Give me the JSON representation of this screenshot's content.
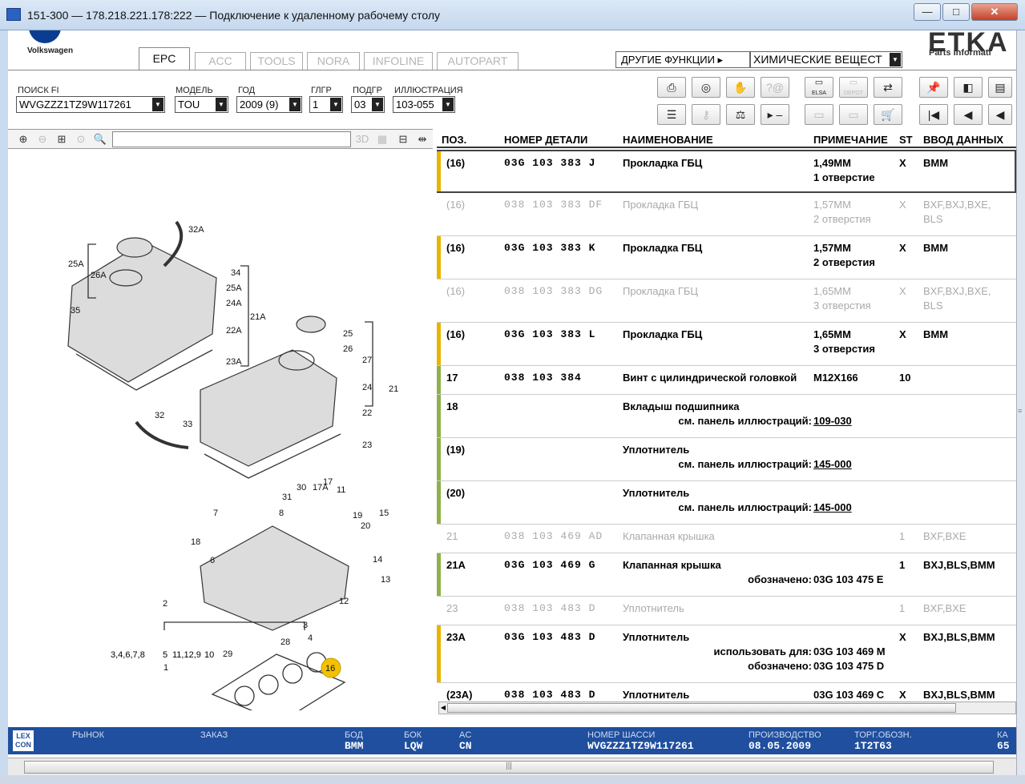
{
  "window": {
    "title": "151-300 — 178.218.221.178:222 — Подключение к удаленному рабочему столу",
    "minimize": "—",
    "restore": "□",
    "close": "✕"
  },
  "brand": {
    "vw": "Volkswagen",
    "etka": "ETKA",
    "etka_sub": "Parts Informati"
  },
  "tabs": [
    "EPC",
    "ACC",
    "TOOLS",
    "NORA",
    "INFOLINE",
    "AUTOPART"
  ],
  "other_functions": "ДРУГИЕ ФУНКЦИИ ▸",
  "chem_select": "ХИМИЧЕСКИЕ ВЕЩЕСТ",
  "fields": {
    "fi_label": "ПОИСК FI",
    "fi_value": "WVGZZZ1TZ9W117261",
    "model_label": "МОДЕЛЬ",
    "model_value": "TOU",
    "year_label": "ГОД",
    "year_value": "2009 (9)",
    "glgr_label": "ГЛГР",
    "glgr_value": "1",
    "podgr_label": "ПОДГР",
    "podgr_value": "03",
    "illu_label": "ИЛЛЮСТРАЦИЯ",
    "illu_value": "103-055"
  },
  "toolbar_icons": [
    "print-icon",
    "cd-icon",
    "handshake-icon",
    "question-mail-icon",
    "elsa-icon",
    "depot-icon",
    "cart-flow-icon",
    "pin-icon",
    "pages-back-icon",
    "page-icon",
    "list-icon",
    "key-icon",
    "scale-icon",
    "play-minus-icon",
    "elsa2-icon",
    "depot2-icon",
    "cart-icon",
    "first-icon",
    "prev-icon",
    "back-icon"
  ],
  "toolbar_labels": {
    "elsa": "ELSA",
    "depot": "DEPOT"
  },
  "zoom": {
    "btn_3d": "3D"
  },
  "grid_headers": {
    "pos": "ПОЗ.",
    "part": "НОМЕР ДЕТАЛИ",
    "name": "НАИМЕНОВАНИЕ",
    "note": "ПРИМЕЧАНИЕ",
    "st": "ST",
    "input": "ВВОД ДАННЫХ"
  },
  "rows": [
    {
      "pos": "(16)",
      "part": "03G 103 383 J",
      "name": "Прокладка ГБЦ",
      "note1": "1,49ММ",
      "note2": "1 отверстие",
      "st": "X",
      "input1": "BMM",
      "input2": "",
      "gray": false,
      "bar": "#e8b400"
    },
    {
      "pos": "(16)",
      "part": "038 103 383 DF",
      "name": "Прокладка ГБЦ",
      "note1": "1,57ММ",
      "note2": "2 отверстия",
      "st": "X",
      "input1": "BXF,BXJ,BXE,",
      "input2": "BLS",
      "gray": true,
      "bar": ""
    },
    {
      "pos": "(16)",
      "part": "03G 103 383 K",
      "name": "Прокладка ГБЦ",
      "note1": "1,57ММ",
      "note2": "2 отверстия",
      "st": "X",
      "input1": "BMM",
      "input2": "",
      "gray": false,
      "bar": "#e8b400"
    },
    {
      "pos": "(16)",
      "part": "038 103 383 DG",
      "name": "Прокладка ГБЦ",
      "note1": "1,65ММ",
      "note2": "3 отверстия",
      "st": "X",
      "input1": "BXF,BXJ,BXE,",
      "input2": "BLS",
      "gray": true,
      "bar": ""
    },
    {
      "pos": "(16)",
      "part": "03G 103 383 L",
      "name": "Прокладка ГБЦ",
      "note1": "1,65ММ",
      "note2": "3 отверстия",
      "st": "X",
      "input1": "BMM",
      "input2": "",
      "gray": false,
      "bar": "#e8b400"
    },
    {
      "pos": "17",
      "part": "038 103 384",
      "name": "Винт с цилиндрической головкой",
      "note1": "M12X166",
      "note2": "",
      "st": "10",
      "input1": "",
      "input2": "",
      "gray": false,
      "bar": "#8fb04a"
    },
    {
      "pos": "18",
      "part": "",
      "name": "Вкладыш подшипника",
      "sub_label": "см. панель иллюстраций:",
      "sub_value": "109-030",
      "st": "",
      "input1": "",
      "gray": false,
      "bar": "#8fb04a"
    },
    {
      "pos": "(19)",
      "part": "",
      "name": "Уплотнитель",
      "sub_label": "см. панель иллюстраций:",
      "sub_value": "145-000",
      "st": "",
      "input1": "",
      "gray": false,
      "bar": "#8fb04a"
    },
    {
      "pos": "(20)",
      "part": "",
      "name": "Уплотнитель",
      "sub_label": "см. панель иллюстраций:",
      "sub_value": "145-000",
      "st": "",
      "input1": "",
      "gray": false,
      "bar": "#8fb04a"
    },
    {
      "pos": "21",
      "part": "038 103 469 AD",
      "name": "Клапанная крышка",
      "note1": "",
      "st": "1",
      "input1": "BXF,BXE",
      "gray": true,
      "bar": ""
    },
    {
      "pos": "21A",
      "part": "03G 103 469 G",
      "name": "Клапанная крышка",
      "sub_label": "обозначено:",
      "sub_value": "03G 103 475 E",
      "st": "1",
      "input1": "BXJ,BLS,BMM",
      "gray": false,
      "bar": "#8fb04a"
    },
    {
      "pos": "23",
      "part": "038 103 483 D",
      "name": "Уплотнитель",
      "note1": "",
      "st": "1",
      "input1": "BXF,BXE",
      "gray": true,
      "bar": ""
    },
    {
      "pos": "23A",
      "part": "03G 103 483 D",
      "name": "Уплотнитель",
      "sub_label": "использовать для:",
      "sub_value": "03G 103 469 M",
      "sub_label2": "обозначено:",
      "sub_value2": "03G 103 475 D",
      "st": "X",
      "input1": "BXJ,BLS,BMM",
      "gray": false,
      "bar": "#e8b400"
    },
    {
      "pos": "(23A)",
      "part": "038 103 483 D",
      "name": "Уплотнитель",
      "note1": "03G 103 469 C",
      "st": "X",
      "input1": "BXJ,BLS,BMM",
      "gray": false,
      "bar": ""
    }
  ],
  "status": {
    "lex": "LEX CON",
    "market_label": "РЫНОК",
    "order_label": "ЗАКАЗ",
    "bod_label": "БОД",
    "bod_value": "BMM",
    "bok_label": "БОК",
    "bok_value": "LQW",
    "ac_label": "AC",
    "ac_value": "CN",
    "chassis_label": "НОМЕР ШАССИ",
    "chassis_value": "WVGZZZ1TZ9W117261",
    "prod_label": "ПРОИЗВОДСТВО",
    "prod_value": "08.05.2009",
    "torg_label": "ТОРГ.ОБОЗН.",
    "torg_value": "1T2T63",
    "ka_label": "КА",
    "ka_value": "65"
  },
  "illustration_labels": [
    "32A",
    "25A",
    "26A",
    "34",
    "25A",
    "24A",
    "21A",
    "35",
    "22A",
    "23A",
    "25",
    "26",
    "27",
    "24",
    "21",
    "22",
    "23",
    "32",
    "33",
    "30",
    "17A",
    "17",
    "11",
    "31",
    "7",
    "8",
    "19",
    "15",
    "20",
    "18",
    "6",
    "14",
    "13",
    "2",
    "12",
    "3",
    "4",
    "28",
    "29",
    "1",
    "16"
  ],
  "illustration_group_1": "3,4,6,7,8",
  "illustration_group_5": "5",
  "illustration_group_11": "11,12,9",
  "illustration_group_10": "10"
}
